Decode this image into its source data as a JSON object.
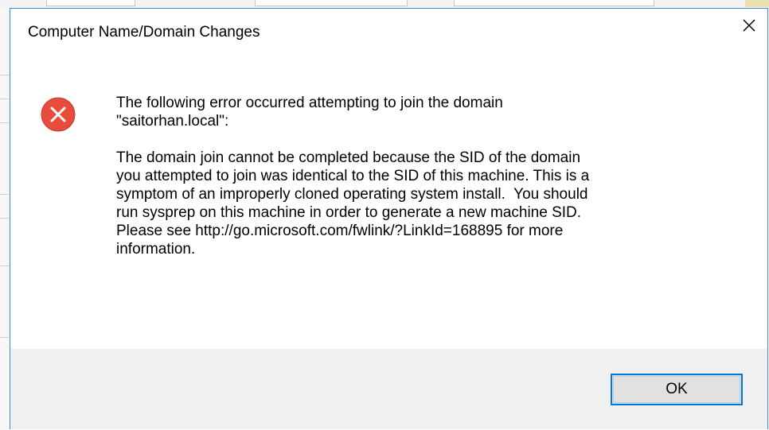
{
  "dialog": {
    "title": "Computer Name/Domain Changes",
    "close_icon": "close-icon",
    "status_icon": "error-icon",
    "colors": {
      "error_red": "#e81123",
      "accent_border": "#0078d7",
      "footer_bg": "#f0f0f0"
    },
    "message": {
      "line1": "The following error occurred attempting to join the domain\n\"saitorhan.local\":",
      "line2": "The domain join cannot be completed because the SID of the domain\nyou attempted to join was identical to the SID of this machine. This is a\nsymptom of an improperly cloned operating system install.  You should\nrun sysprep on this machine in order to generate a new machine SID.\nPlease see http://go.microsoft.com/fwlink/?LinkId=168895 for more\ninformation."
    },
    "buttons": {
      "ok_label": "OK"
    }
  }
}
